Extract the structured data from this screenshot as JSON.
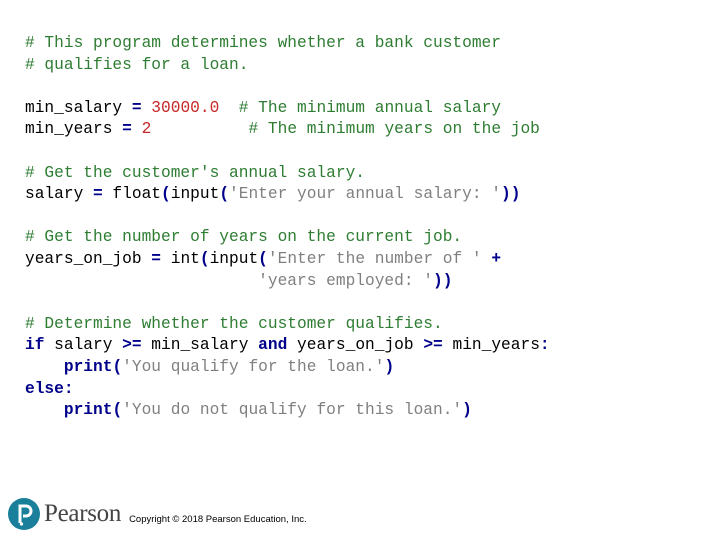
{
  "code": {
    "lines": [
      [
        {
          "t": "cm",
          "v": "# This program determines whether a bank customer"
        }
      ],
      [
        {
          "t": "cm",
          "v": "# qualifies for a loan."
        }
      ],
      [],
      [
        {
          "t": "",
          "v": "min_salary "
        },
        {
          "t": "op",
          "v": "="
        },
        {
          "t": "",
          "v": " "
        },
        {
          "t": "num",
          "v": "30000.0"
        },
        {
          "t": "",
          "v": "  "
        },
        {
          "t": "cm",
          "v": "# The minimum annual salary"
        }
      ],
      [
        {
          "t": "",
          "v": "min_years "
        },
        {
          "t": "op",
          "v": "="
        },
        {
          "t": "",
          "v": " "
        },
        {
          "t": "num",
          "v": "2"
        },
        {
          "t": "",
          "v": "          "
        },
        {
          "t": "cm",
          "v": "# The minimum years on the job"
        }
      ],
      [],
      [
        {
          "t": "cm",
          "v": "# Get the customer's annual salary."
        }
      ],
      [
        {
          "t": "",
          "v": "salary "
        },
        {
          "t": "op",
          "v": "="
        },
        {
          "t": "",
          "v": " float"
        },
        {
          "t": "op",
          "v": "("
        },
        {
          "t": "",
          "v": "input"
        },
        {
          "t": "op",
          "v": "("
        },
        {
          "t": "str",
          "v": "'Enter your annual salary: '"
        },
        {
          "t": "op",
          "v": "))"
        }
      ],
      [],
      [
        {
          "t": "cm",
          "v": "# Get the number of years on the current job."
        }
      ],
      [
        {
          "t": "",
          "v": "years_on_job "
        },
        {
          "t": "op",
          "v": "="
        },
        {
          "t": "",
          "v": " int"
        },
        {
          "t": "op",
          "v": "("
        },
        {
          "t": "",
          "v": "input"
        },
        {
          "t": "op",
          "v": "("
        },
        {
          "t": "str",
          "v": "'Enter the number of '"
        },
        {
          "t": "",
          "v": " "
        },
        {
          "t": "op",
          "v": "+"
        }
      ],
      [
        {
          "t": "",
          "v": "                        "
        },
        {
          "t": "str",
          "v": "'years employed: '"
        },
        {
          "t": "op",
          "v": "))"
        }
      ],
      [],
      [
        {
          "t": "cm",
          "v": "# Determine whether the customer qualifies."
        }
      ],
      [
        {
          "t": "kw",
          "v": "if"
        },
        {
          "t": "",
          "v": " salary "
        },
        {
          "t": "op",
          "v": ">="
        },
        {
          "t": "",
          "v": " min_salary "
        },
        {
          "t": "kw",
          "v": "and"
        },
        {
          "t": "",
          "v": " years_on_job "
        },
        {
          "t": "op",
          "v": ">="
        },
        {
          "t": "",
          "v": " min_years"
        },
        {
          "t": "op",
          "v": ":"
        }
      ],
      [
        {
          "t": "",
          "v": "    "
        },
        {
          "t": "kw",
          "v": "print"
        },
        {
          "t": "op",
          "v": "("
        },
        {
          "t": "str",
          "v": "'You qualify for the loan.'"
        },
        {
          "t": "op",
          "v": ")"
        }
      ],
      [
        {
          "t": "kw",
          "v": "else"
        },
        {
          "t": "op",
          "v": ":"
        }
      ],
      [
        {
          "t": "",
          "v": "    "
        },
        {
          "t": "kw",
          "v": "print"
        },
        {
          "t": "op",
          "v": "("
        },
        {
          "t": "str",
          "v": "'You do not qualify for this loan.'"
        },
        {
          "t": "op",
          "v": ")"
        }
      ]
    ]
  },
  "footer": {
    "logo_icon": "pearson-p-logo-icon",
    "brand": "Pearson",
    "copyright": "Copyright © 2018 Pearson Education, Inc.",
    "logo_color": "#1a7f9a"
  }
}
